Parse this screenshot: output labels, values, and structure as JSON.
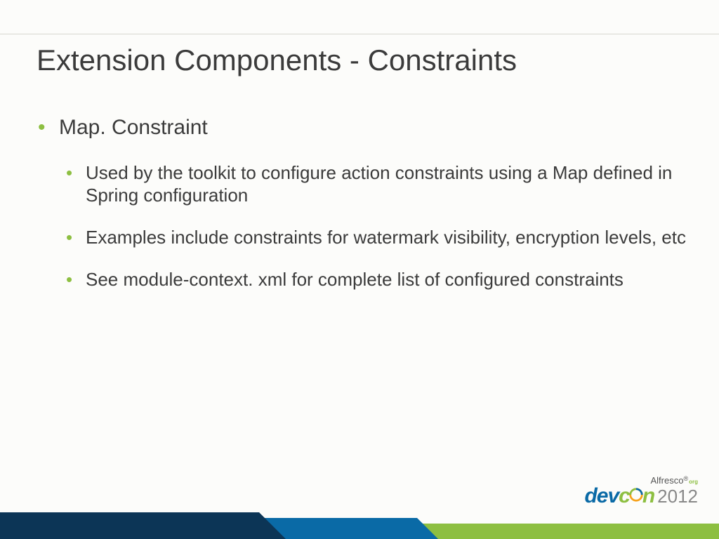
{
  "title": "Extension Components - Constraints",
  "bullets": {
    "main": "Map. Constraint",
    "subs": [
      "Used by the toolkit to configure action constraints using a Map defined in Spring configuration",
      "Examples include constraints for watermark visibility, encryption levels, etc",
      "See module-context. xml for complete list of configured constraints"
    ]
  },
  "footer": {
    "brand_top": "Alfresco",
    "brand_top_tag": "org",
    "logo_dev": "dev",
    "logo_con": "c   n",
    "year": "2012"
  }
}
